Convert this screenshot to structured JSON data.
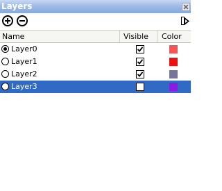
{
  "window": {
    "title": "Layers"
  },
  "toolbar": {
    "add_icon": "plus-circle-icon",
    "remove_icon": "minus-circle-icon",
    "details_icon": "details-arrow-icon"
  },
  "columns": {
    "name": "Name",
    "visible": "Visible",
    "color": "Color"
  },
  "layers": [
    {
      "name": "Layer0",
      "active": true,
      "visible": true,
      "color": "#f25757",
      "selected": false
    },
    {
      "name": "Layer1",
      "active": false,
      "visible": true,
      "color": "#ee1111",
      "selected": false
    },
    {
      "name": "Layer2",
      "active": false,
      "visible": true,
      "color": "#77759a",
      "selected": false
    },
    {
      "name": "Layer3",
      "active": false,
      "visible": false,
      "color": "#8a1be2",
      "selected": true
    }
  ],
  "colors": {
    "title_bar": "#9ebbe8",
    "selection": "#316ac5"
  }
}
